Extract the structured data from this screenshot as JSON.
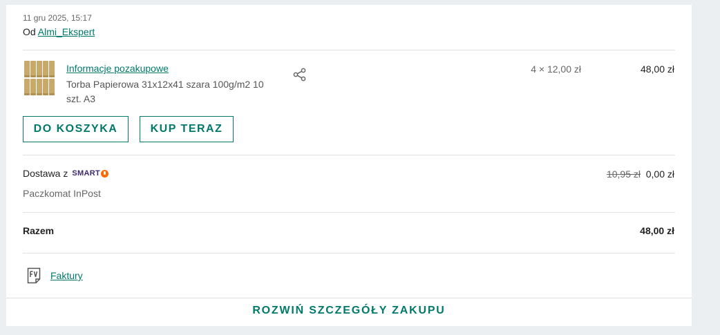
{
  "order": {
    "date": "11 gru 2025, 15:17",
    "seller_prefix": "Od ",
    "seller_name": "Almi_Ekspert"
  },
  "item": {
    "info_link": "Informacje pozakupowe",
    "name": "Torba Papierowa 31x12x41 szara 100g/m2 10 szt. A3",
    "quantity_price": "4 × 12,00 zł",
    "total": "48,00 zł",
    "thumbnail_icon": "paper-bags-image",
    "share_icon": "share-icon"
  },
  "actions": {
    "add_to_cart": "DO KOSZYKA",
    "buy_now": "KUP TERAZ"
  },
  "delivery": {
    "label": "Dostawa z",
    "brand": "SMART",
    "old_price": "10,95 zł",
    "price": "0,00 zł",
    "method": "Paczkomat InPost"
  },
  "summary": {
    "label": "Razem",
    "value": "48,00 zł"
  },
  "invoices": {
    "icon": "fv-invoice-icon",
    "label": "Faktury"
  },
  "footer": {
    "expand_label": "ROZWIŃ SZCZEGÓŁY ZAKUPU"
  },
  "colors": {
    "accent": "#00796b",
    "background": "#eceff1",
    "smart_badge": "#ff6a00"
  }
}
